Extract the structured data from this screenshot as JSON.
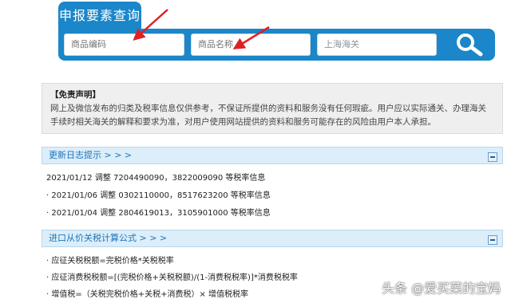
{
  "search": {
    "tab_title": "申报要素查询",
    "product_code_placeholder": "商品编码",
    "product_name_placeholder": "商品名称",
    "customs_value": "上海海关"
  },
  "disclaimer": {
    "title": "【免责声明】",
    "text": "网上及微信发布的归类及税率信息仅供参考，不保证所提供的资料和服务没有任何瑕疵。用户应以实际通关、办理海关手续时相关海关的解释和要求为准，对用户使用网站提供的资料和服务可能存在的风险由用户本人承担。"
  },
  "update_log": {
    "title": "更新日志提示 > > >",
    "entries": [
      "2021/01/12 调整 7204490090，3822009090 等税率信息",
      "· 2021/01/06 调整 0302110000，8517623200 等税率信息",
      "· 2021/01/04 调整 2804619013，3105901000 等税率信息"
    ]
  },
  "formula": {
    "title": "进口从价关税计算公式 > > >",
    "lines": [
      "· 应征关税税额=完税价格*关税税率",
      "· 应征消费税税额=[(完税价格+关税税额)/(1-消费税税率)]*消费税税率",
      "· 增值税=（关税完税价格+关税+消费税）× 增值税税率"
    ]
  },
  "watermark": "头条 @爱买菜的宝妈",
  "colors": {
    "accent": "#1b86c9",
    "arrow": "#e02020"
  }
}
